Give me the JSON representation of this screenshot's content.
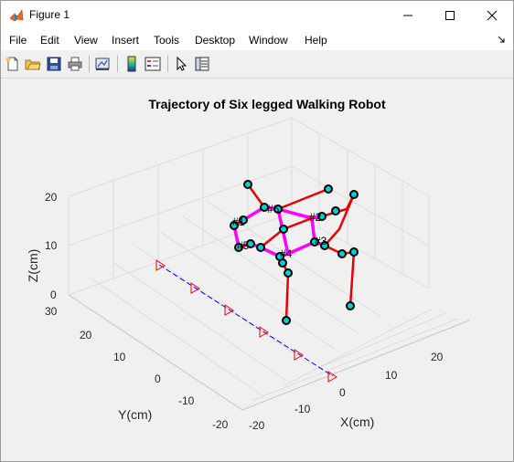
{
  "window": {
    "title": "Figure 1",
    "controls": [
      "minimize",
      "maximize",
      "close"
    ]
  },
  "menu": {
    "items": [
      "File",
      "Edit",
      "View",
      "Insert",
      "Tools",
      "Desktop",
      "Window",
      "Help"
    ]
  },
  "toolbar": {
    "buttons": [
      "new-figure-icon",
      "open-file-icon",
      "save-icon",
      "print-icon",
      "link-plot-icon",
      "colorbar-icon",
      "legend-icon",
      "pointer-icon",
      "property-editor-icon"
    ]
  },
  "figure": {
    "title": "Trajectory of Six legged Walking Robot",
    "xlabel": "X(cm)",
    "ylabel": "Y(cm)",
    "zlabel": "Z(cm)",
    "xticks": [
      "-20",
      "-10",
      "0",
      "10",
      "20"
    ],
    "yticks": [
      "-20",
      "-10",
      "0",
      "10",
      "20",
      "30"
    ],
    "zticks": [
      "0",
      "10",
      "20"
    ],
    "leg_labels": [
      "#1",
      "#2",
      "#3",
      "#4",
      "#5",
      "#6"
    ],
    "colors": {
      "leg_line": "#e60000",
      "body_line": "#ff00ff",
      "joint_fill": "#00d0d0",
      "path_line": "#0000ff",
      "path_marker": "#ff0000"
    }
  },
  "chart_data": {
    "type": "line3d",
    "title": "Trajectory of Six legged Walking Robot",
    "xlabel": "X(cm)",
    "ylabel": "Y(cm)",
    "zlabel": "Z(cm)",
    "xlim": [
      -20,
      30
    ],
    "ylim": [
      -20,
      30
    ],
    "zlim": [
      0,
      20
    ],
    "grid": true,
    "path_markers": {
      "marker": "triangle-right",
      "color": "#ff0000",
      "x": [
        -21,
        -15,
        -8,
        -1,
        6,
        13
      ],
      "y": [
        28,
        22,
        15,
        8,
        1,
        -6
      ],
      "z": [
        0,
        0,
        0,
        0,
        0,
        0
      ]
    }
  }
}
